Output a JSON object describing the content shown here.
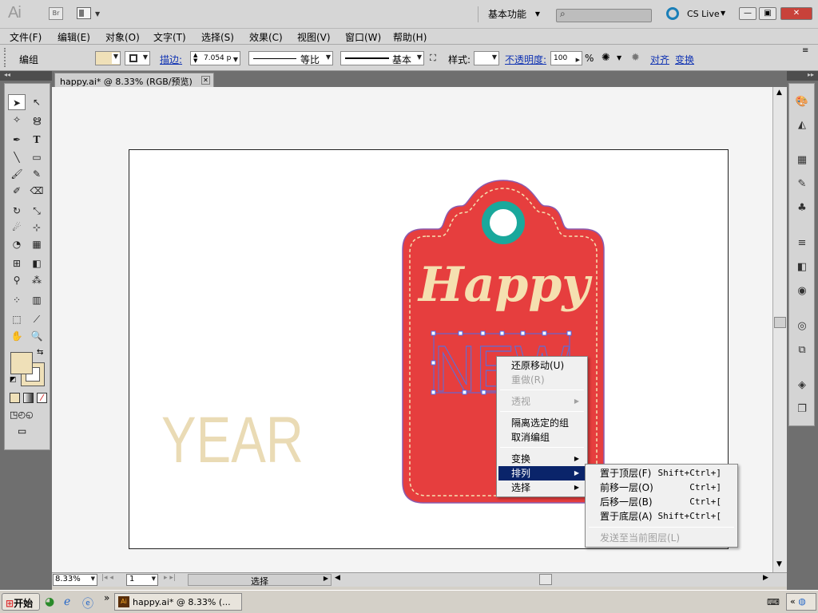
{
  "app": {
    "logo": "Ai",
    "bridge": "Br",
    "workspace": "基本功能",
    "cslive": "CS Live"
  },
  "menus": [
    "文件(F)",
    "编辑(E)",
    "对象(O)",
    "文字(T)",
    "选择(S)",
    "效果(C)",
    "视图(V)",
    "窗口(W)",
    "帮助(H)"
  ],
  "control": {
    "group_label": "编组",
    "stroke_label": "描边:",
    "stroke_value": "7.054 p",
    "profile": "等比",
    "brush": "基本",
    "style_label": "样式:",
    "opacity_label": "不透明度:",
    "opacity_value": "100",
    "opacity_unit": "%",
    "align": "对齐",
    "transform": "变换"
  },
  "document": {
    "tab_title": "happy.ai* @ 8.33% (RGB/预览)"
  },
  "artwork": {
    "happy": "Happy",
    "new": "NEW",
    "year": "YEAR",
    "tag_color": "#e63e3e",
    "ring_color": "#1aa89c",
    "text_color": "#f5e0b0",
    "year_color": "#eadbb5"
  },
  "context_menu": {
    "items": [
      {
        "label": "还原移动(U)",
        "state": "normal"
      },
      {
        "label": "重做(R)",
        "state": "disabled"
      },
      {
        "label": "透视",
        "state": "disabled"
      },
      {
        "label": "隔离选定的组",
        "state": "normal"
      },
      {
        "label": "取消编组",
        "state": "normal"
      },
      {
        "label": "变换",
        "state": "normal"
      },
      {
        "label": "排列",
        "state": "selected"
      },
      {
        "label": "选择",
        "state": "normal"
      }
    ]
  },
  "arrange_submenu": {
    "items": [
      {
        "label": "置于顶层(F)",
        "shortcut": "Shift+Ctrl+]",
        "state": "normal"
      },
      {
        "label": "前移一层(O)",
        "shortcut": "Ctrl+]",
        "state": "normal"
      },
      {
        "label": "后移一层(B)",
        "shortcut": "Ctrl+[",
        "state": "normal"
      },
      {
        "label": "置于底层(A)",
        "shortcut": "Shift+Ctrl+[",
        "state": "normal"
      },
      {
        "label": "发送至当前图层(L)",
        "shortcut": "",
        "state": "disabled"
      }
    ]
  },
  "status": {
    "zoom": "8.33%",
    "page": "1",
    "info": "选择"
  },
  "taskbar": {
    "start": "开始",
    "window": "happy.ai* @ 8.33% (..."
  }
}
